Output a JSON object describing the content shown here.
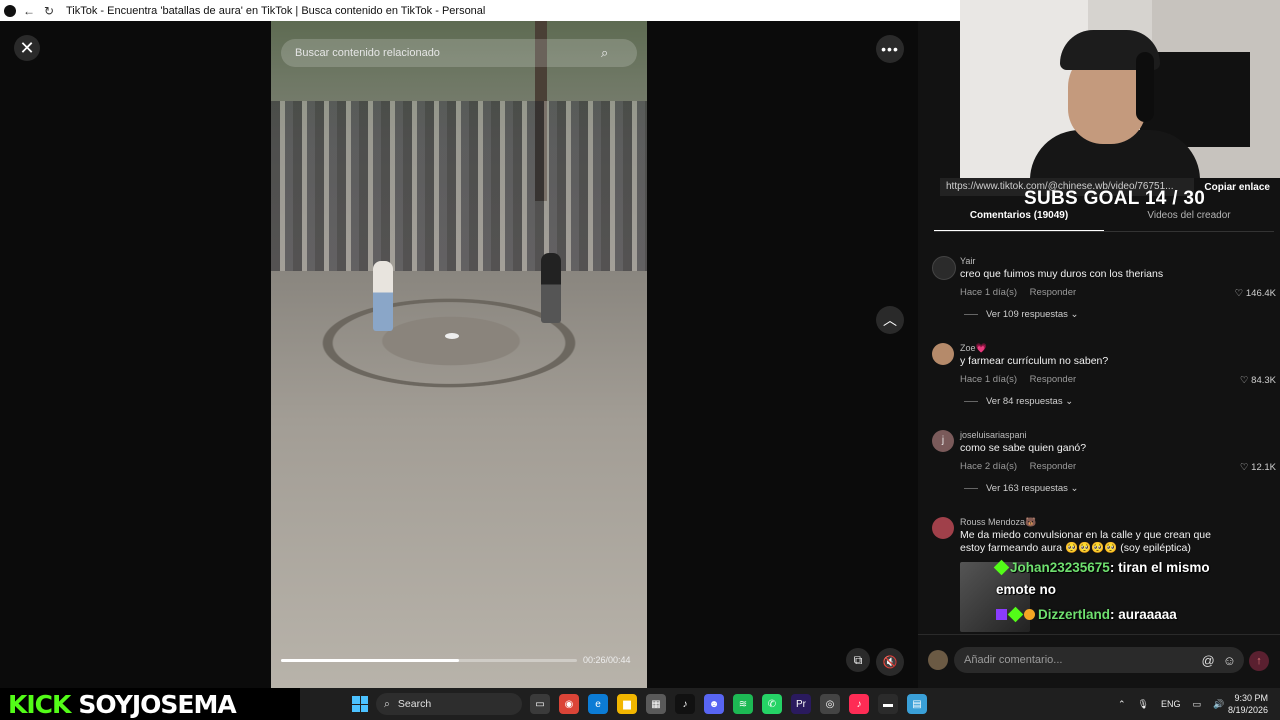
{
  "browser": {
    "title": "TikTok - Encuentra 'batallas de aura' en TikTok | Busca contenido en TikTok - Personal"
  },
  "video": {
    "search_placeholder": "Buscar contenido relacionado",
    "timecode": "00:26/00:44",
    "progress_fraction": 0.6
  },
  "panel": {
    "link_url": "https://www.tiktok.com/@chinese.wb/video/76751...",
    "copy_link": "Copiar enlace",
    "tabs": [
      {
        "label": "Comentarios (19049)"
      },
      {
        "label": "Videos del creador"
      }
    ],
    "reply_label": "Responder",
    "comments": [
      {
        "user": "Yair",
        "text": "creo que fuimos muy duros con los therians",
        "time": "Hace 1 día(s)",
        "likes": "146.4K",
        "replies": "Ver 109 respuestas",
        "avatar_color": "#2b2b2b"
      },
      {
        "user": "Zoe💗",
        "text": "y farmear currículum no saben?",
        "time": "Hace 1 día(s)",
        "likes": "84.3K",
        "replies": "Ver 84 respuestas",
        "avatar_color": "#b58a6a"
      },
      {
        "user": "joseluisariaspani",
        "text": "como se sabe quien ganó?",
        "time": "Hace 2 día(s)",
        "likes": "12.1K",
        "replies": "Ver 163 respuestas",
        "avatar_color": "#7a5a5a",
        "avatar_letter": "j"
      },
      {
        "user": "Rouss Mendoza🐻",
        "text": "Me da miedo convulsionar en la calle y que crean que estoy farmeando aura 🥺🥺🥺🥺 (soy epiléptica)",
        "avatar_color": "#a0404a"
      }
    ],
    "comment_placeholder": "Añadir comentario...",
    "comment_icons": {
      "mention": "@",
      "emoji": "☺",
      "send": "↑"
    }
  },
  "overlay": {
    "subs_goal": "SUBS GOAL 14 / 30",
    "chat": [
      {
        "user": "Johan23235675",
        "message": ": tiran el mismo",
        "cont": "emote no"
      },
      {
        "user": "Dizzertland",
        "message": ": auraaaaa"
      }
    ]
  },
  "taskbar": {
    "kick_logo": "KICK",
    "kick_user": "SOYJOSEMA",
    "search_placeholder": "Search",
    "lang": "ENG",
    "time": "9:30 PM",
    "date": "8/19/2026",
    "apps": [
      {
        "name": "task-view-icon",
        "color": "#3a3a3a",
        "glyph": "▭"
      },
      {
        "name": "chrome-icon",
        "color": "#db4437",
        "glyph": "◉"
      },
      {
        "name": "edge-icon",
        "color": "#0c7cd5",
        "glyph": "e"
      },
      {
        "name": "explorer-icon",
        "color": "#f2b600",
        "glyph": "▆"
      },
      {
        "name": "store-icon",
        "color": "#5a5a5a",
        "glyph": "▦"
      },
      {
        "name": "tiktok-icon",
        "color": "#111",
        "glyph": "♪"
      },
      {
        "name": "discord-icon",
        "color": "#5865f2",
        "glyph": "☻"
      },
      {
        "name": "spotify-icon",
        "color": "#1db954",
        "glyph": "≋"
      },
      {
        "name": "whatsapp-icon",
        "color": "#25d366",
        "glyph": "✆"
      },
      {
        "name": "premiere-icon",
        "color": "#2a1a5e",
        "glyph": "Pr"
      },
      {
        "name": "obs-icon",
        "color": "#444",
        "glyph": "◎"
      },
      {
        "name": "tiktok-live-icon",
        "color": "#fe2c55",
        "glyph": "♪"
      },
      {
        "name": "terminal-icon",
        "color": "#2b2b2b",
        "glyph": "▬"
      },
      {
        "name": "notepad-icon",
        "color": "#3aa0d8",
        "glyph": "▤"
      }
    ]
  }
}
